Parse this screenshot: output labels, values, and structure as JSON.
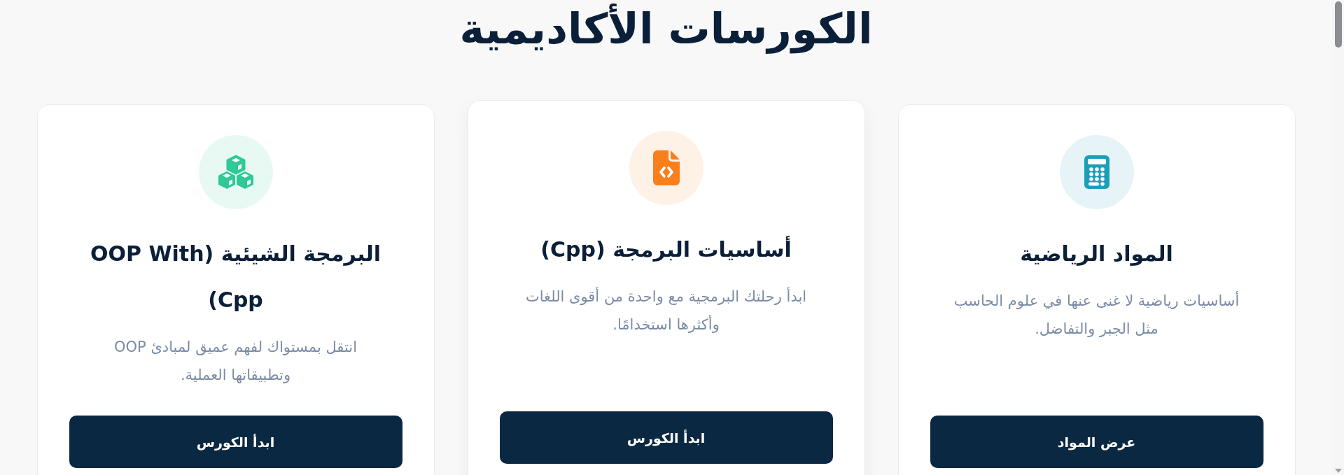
{
  "heading": "الكورسات الأكاديمية",
  "courses": [
    {
      "title": "المواد الرياضية",
      "description": "أساسيات رياضية لا غنى عنها في علوم الحاسب مثل الجبر والتفاضل.",
      "button": "عرض المواد",
      "color": "#1b9fb7",
      "hovered": false
    },
    {
      "title": "أساسيات البرمجة (Cpp)",
      "description": "ابدأ رحلتك البرمجية مع واحدة من أقوى اللغات وأكثرها استخدامًا.",
      "button": "ابدأ الكورس",
      "color": "#f97f1c",
      "hovered": true
    },
    {
      "title": "البرمجة الشيئية (OOP With Cpp)",
      "description": "انتقل بمستواك لفهم عميق لمبادئ OOP وتطبيقاتها العملية.",
      "button": "ابدأ الكورس",
      "color": "#2ec996",
      "hovered": false
    }
  ]
}
